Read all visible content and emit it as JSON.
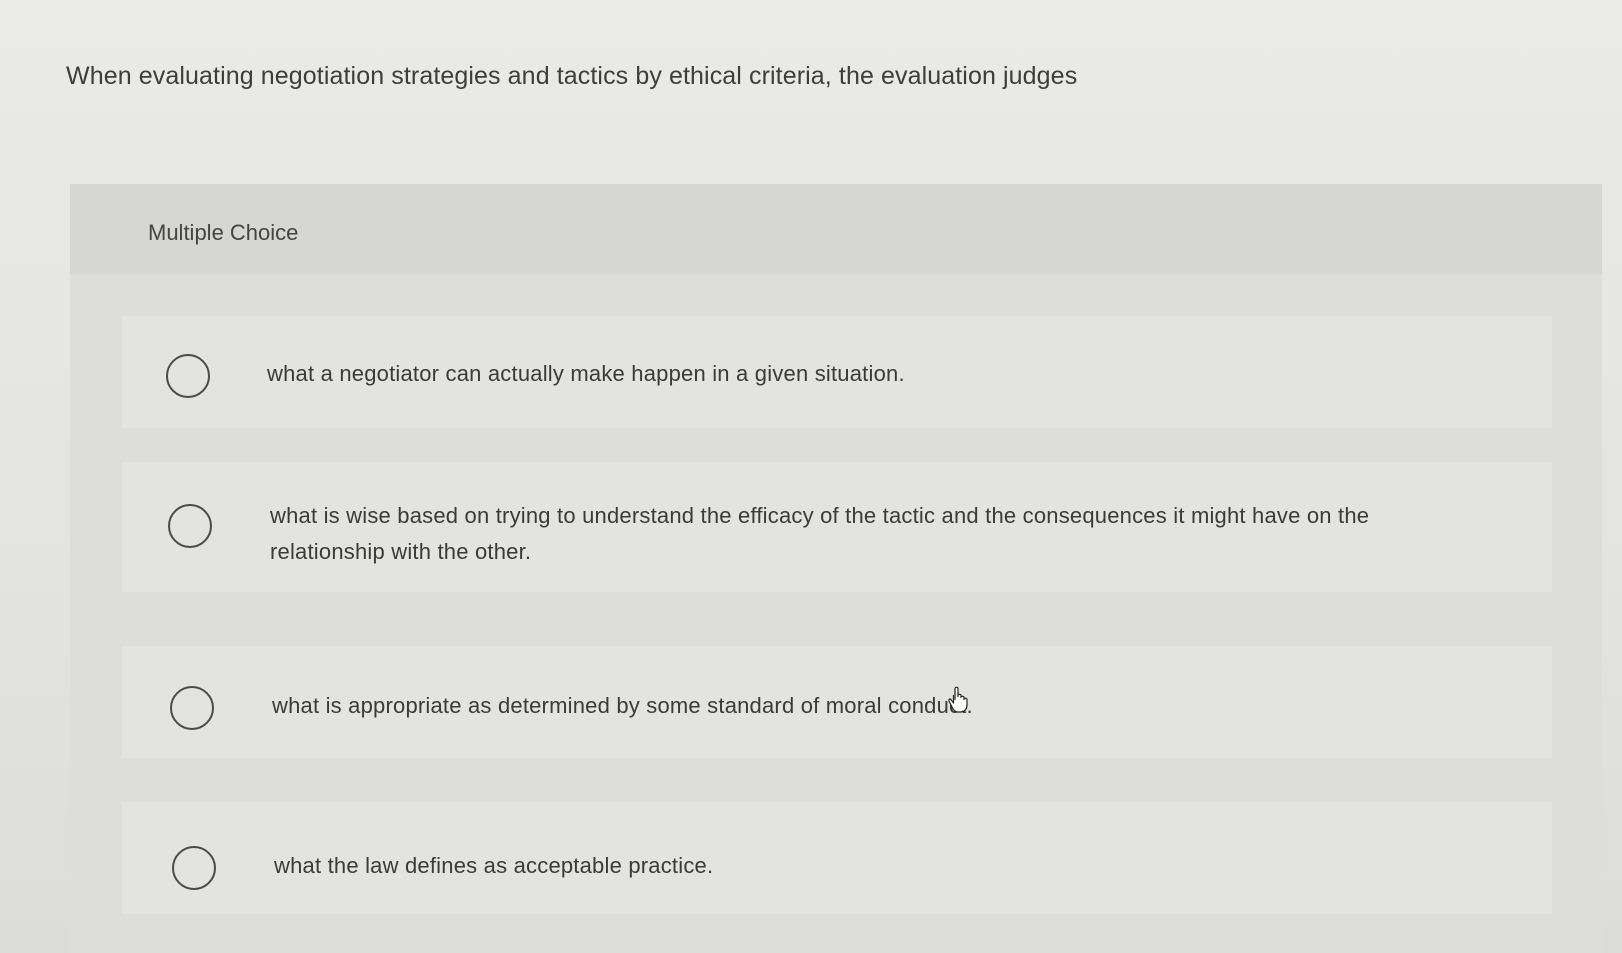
{
  "question": {
    "text": "When evaluating negotiation strategies and tactics by ethical criteria, the evaluation judges"
  },
  "card": {
    "title": "Multiple Choice"
  },
  "options": [
    {
      "text": "what a negotiator can actually make happen in a given situation."
    },
    {
      "text": "what is wise based on trying to understand the efficacy of the tactic and the consequences it might have on the relationship with the other."
    },
    {
      "text": "what is appropriate as determined by some standard of moral conduct."
    },
    {
      "text": "what the law defines as acceptable practice."
    }
  ],
  "icons": {
    "radio": "radio-unselected-icon",
    "cursor": "hand-pointer-icon"
  }
}
